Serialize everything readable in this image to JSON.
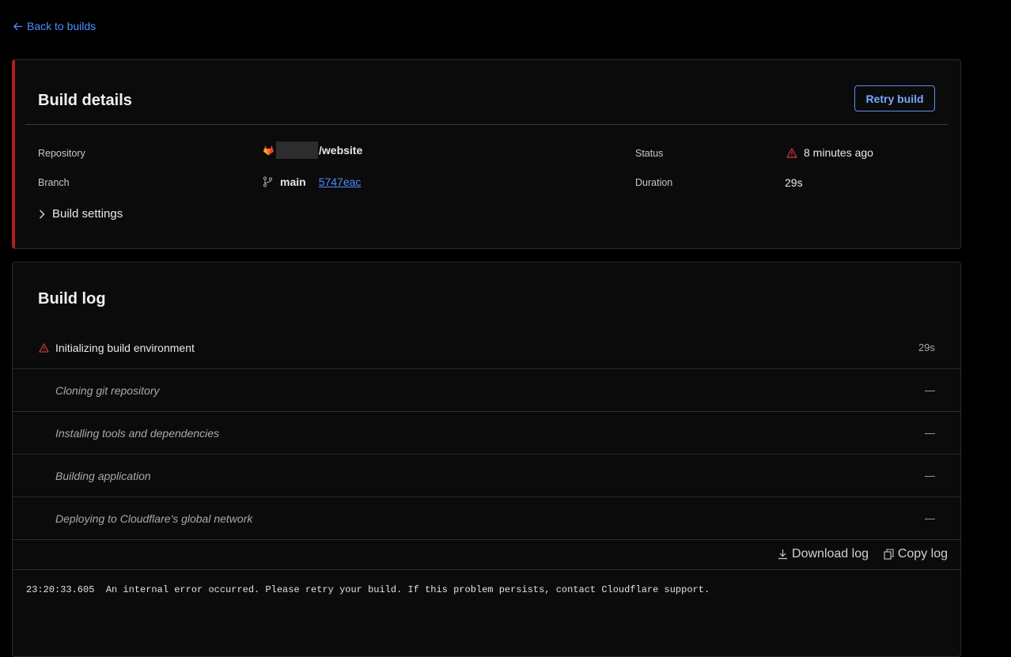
{
  "nav": {
    "back_label": "Back to builds"
  },
  "details": {
    "title": "Build details",
    "retry_label": "Retry build",
    "repository_label": "Repository",
    "repository_value": "/website",
    "branch_label": "Branch",
    "branch_value": "main",
    "commit_value": "5747eac",
    "status_label": "Status",
    "status_value": "8 minutes ago",
    "duration_label": "Duration",
    "duration_value": "29s",
    "settings_label": "Build settings"
  },
  "log": {
    "title": "Build log",
    "steps": [
      {
        "label": "Initializing build environment",
        "time": "29s",
        "state": "error"
      },
      {
        "label": "Cloning git repository",
        "time": "—",
        "state": "pending"
      },
      {
        "label": "Installing tools and dependencies",
        "time": "—",
        "state": "pending"
      },
      {
        "label": "Building application",
        "time": "—",
        "state": "pending"
      },
      {
        "label": "Deploying to Cloudflare's global network",
        "time": "—",
        "state": "pending"
      }
    ],
    "download_label": "Download log",
    "copy_label": "Copy log",
    "output_line": "23:20:33.605  An internal error occurred. Please retry your build. If this problem persists, contact Cloudflare support."
  },
  "colors": {
    "accent": "#4d8dff",
    "error": "#d33a3a",
    "error_border": "#b31d1d",
    "card_bg": "#0b0b0c"
  },
  "icons": [
    "arrow-left-icon",
    "gitlab-icon",
    "git-branch-icon",
    "warning-icon",
    "chevron-right-icon",
    "download-icon",
    "copy-icon"
  ]
}
